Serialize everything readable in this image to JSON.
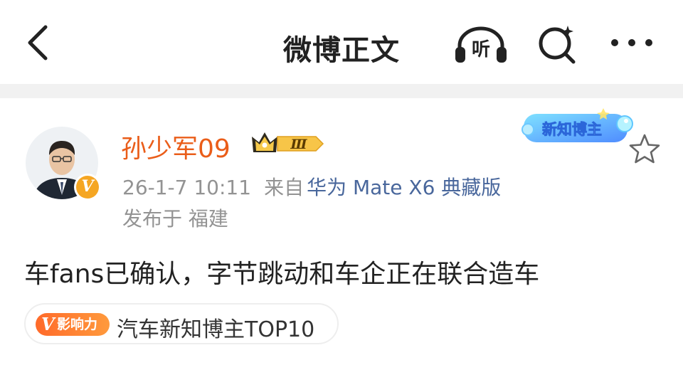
{
  "header": {
    "title": "微博正文",
    "back_icon": "chevron-left-icon",
    "listen_label": "听",
    "search_icon": "search-icon",
    "more_icon": "more-dots-icon"
  },
  "post": {
    "author": {
      "name": "孙少军09",
      "avatar_icon": "avatar",
      "verified_badge_letter": "V",
      "crown_level": "Ⅲ",
      "name_color": "#ea5d19"
    },
    "meta": {
      "time": "26-1-7 10:11",
      "source_prefix": "来自",
      "source": "华为 Mate X6 典藏版",
      "location": "发布于 福建"
    },
    "creator_badge": "新知博主",
    "text": "车fans已确认，字节跳动和车企正在联合造车",
    "influence": {
      "badge_letter": "V",
      "badge_text": "影响力",
      "label": "汽车新知博主TOP10"
    }
  },
  "colors": {
    "accent_orange": "#ea5d19",
    "link_blue": "#49679c",
    "meta_gray": "#939393"
  }
}
